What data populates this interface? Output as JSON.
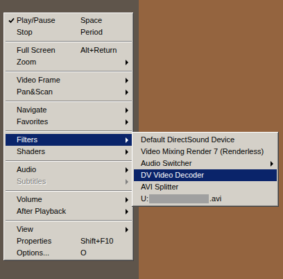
{
  "menu": {
    "items": [
      {
        "kind": "item",
        "label": "Play/Pause",
        "shortcut": "Space",
        "checked": true,
        "submenu": false,
        "selected": false,
        "disabled": false
      },
      {
        "kind": "item",
        "label": "Stop",
        "shortcut": "Period",
        "checked": false,
        "submenu": false,
        "selected": false,
        "disabled": false
      },
      {
        "kind": "separator"
      },
      {
        "kind": "item",
        "label": "Full Screen",
        "shortcut": "Alt+Return",
        "checked": false,
        "submenu": false,
        "selected": false,
        "disabled": false
      },
      {
        "kind": "item",
        "label": "Zoom",
        "shortcut": "",
        "checked": false,
        "submenu": true,
        "selected": false,
        "disabled": false
      },
      {
        "kind": "separator"
      },
      {
        "kind": "item",
        "label": "Video Frame",
        "shortcut": "",
        "checked": false,
        "submenu": true,
        "selected": false,
        "disabled": false
      },
      {
        "kind": "item",
        "label": "Pan&Scan",
        "shortcut": "",
        "checked": false,
        "submenu": true,
        "selected": false,
        "disabled": false
      },
      {
        "kind": "separator"
      },
      {
        "kind": "item",
        "label": "Navigate",
        "shortcut": "",
        "checked": false,
        "submenu": true,
        "selected": false,
        "disabled": false
      },
      {
        "kind": "item",
        "label": "Favorites",
        "shortcut": "",
        "checked": false,
        "submenu": true,
        "selected": false,
        "disabled": false
      },
      {
        "kind": "separator"
      },
      {
        "kind": "item",
        "label": "Filters",
        "shortcut": "",
        "checked": false,
        "submenu": true,
        "selected": true,
        "disabled": false
      },
      {
        "kind": "item",
        "label": "Shaders",
        "shortcut": "",
        "checked": false,
        "submenu": true,
        "selected": false,
        "disabled": false
      },
      {
        "kind": "separator"
      },
      {
        "kind": "item",
        "label": "Audio",
        "shortcut": "",
        "checked": false,
        "submenu": true,
        "selected": false,
        "disabled": false
      },
      {
        "kind": "item",
        "label": "Subtitles",
        "shortcut": "",
        "checked": false,
        "submenu": true,
        "selected": false,
        "disabled": true
      },
      {
        "kind": "separator"
      },
      {
        "kind": "item",
        "label": "Volume",
        "shortcut": "",
        "checked": false,
        "submenu": true,
        "selected": false,
        "disabled": false
      },
      {
        "kind": "item",
        "label": "After Playback",
        "shortcut": "",
        "checked": false,
        "submenu": true,
        "selected": false,
        "disabled": false
      },
      {
        "kind": "separator"
      },
      {
        "kind": "item",
        "label": "View",
        "shortcut": "",
        "checked": false,
        "submenu": true,
        "selected": false,
        "disabled": false
      },
      {
        "kind": "item",
        "label": "Properties",
        "shortcut": "Shift+F10",
        "checked": false,
        "submenu": false,
        "selected": false,
        "disabled": false
      },
      {
        "kind": "item",
        "label": "Options...",
        "shortcut": "O",
        "checked": false,
        "submenu": false,
        "selected": false,
        "disabled": false
      }
    ]
  },
  "filters_submenu": {
    "items": [
      {
        "kind": "item",
        "label": "Default DirectSound Device",
        "submenu": false,
        "selected": false
      },
      {
        "kind": "item",
        "label": "Video Mixing Render 7 (Renderless)",
        "submenu": false,
        "selected": false
      },
      {
        "kind": "item",
        "label": "Audio Switcher",
        "submenu": true,
        "selected": false
      },
      {
        "kind": "item",
        "label": "DV Video Decoder",
        "submenu": false,
        "selected": true
      },
      {
        "kind": "item",
        "label": "AVI Splitter",
        "submenu": false,
        "selected": false
      },
      {
        "kind": "file",
        "prefix": "U:",
        "suffix": ".avi",
        "redacted": true,
        "submenu": false,
        "selected": false
      }
    ]
  }
}
